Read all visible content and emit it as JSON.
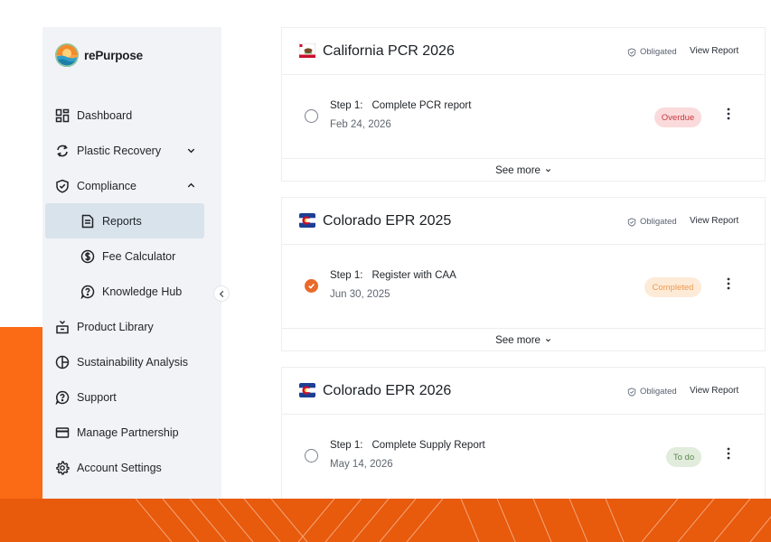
{
  "app": {
    "name": "rePurpose"
  },
  "sidebar": {
    "items": [
      {
        "label": "Dashboard",
        "icon": "dashboard-grid-icon"
      },
      {
        "label": "Plastic Recovery",
        "icon": "recycle-arrows-icon",
        "expanded": false
      },
      {
        "label": "Compliance",
        "icon": "shield-check-icon",
        "expanded": true
      },
      {
        "label": "Reports",
        "icon": "document-icon",
        "active": true
      },
      {
        "label": "Fee Calculator",
        "icon": "dollar-circle-icon"
      },
      {
        "label": "Knowledge Hub",
        "icon": "question-circle-icon"
      },
      {
        "label": "Product Library",
        "icon": "box-icon"
      },
      {
        "label": "Sustainability Analysis",
        "icon": "pie-chart-icon"
      },
      {
        "label": "Support",
        "icon": "question-bubble-icon"
      },
      {
        "label": "Manage Partnership",
        "icon": "credit-card-icon"
      },
      {
        "label": "Account Settings",
        "icon": "gear-icon"
      }
    ]
  },
  "reports": [
    {
      "title": "California PCR 2026",
      "flag": "california-flag-icon",
      "obligated_label": "Obligated",
      "view_report_label": "View Report",
      "step_number": "Step 1:",
      "step_text": "Complete PCR report",
      "date": "Feb 24, 2026",
      "status": "Overdue",
      "status_colors": {
        "bg": "#fadadb",
        "fg": "#c43b40"
      },
      "completed": false,
      "see_more_label": "See more"
    },
    {
      "title": "Colorado EPR 2025",
      "flag": "colorado-flag-icon",
      "obligated_label": "Obligated",
      "view_report_label": "View Report",
      "step_number": "Step 1:",
      "step_text": "Register with CAA",
      "date": "Jun 30, 2025",
      "status": "Completed",
      "status_colors": {
        "bg": "#fdebd8",
        "fg": "#ee9b53"
      },
      "completed": true,
      "see_more_label": "See more"
    },
    {
      "title": "Colorado EPR 2026",
      "flag": "colorado-flag-icon",
      "obligated_label": "Obligated",
      "view_report_label": "View Report",
      "step_number": "Step 1:",
      "step_text": "Complete Supply Report",
      "date": "May 14, 2026",
      "status": "To do",
      "status_colors": {
        "bg": "#e2ecdd",
        "fg": "#5c8a4d"
      },
      "completed": false,
      "see_more_label": "See more"
    }
  ],
  "colors": {
    "accent_orange": "#fb6a14",
    "check_orange": "#e96a2a",
    "sidebar_bg": "#f1f3f7",
    "active_bg": "#d9e3ec"
  }
}
